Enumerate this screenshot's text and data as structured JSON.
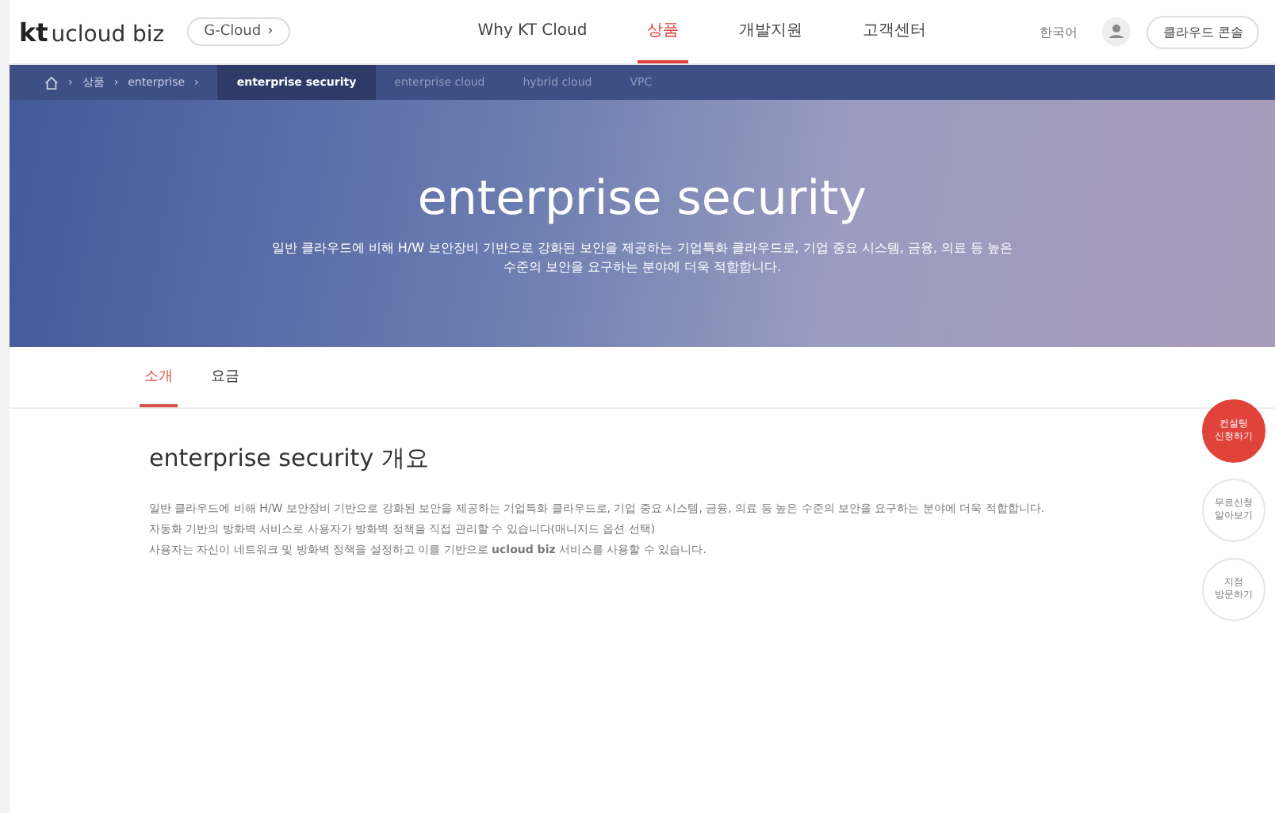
{
  "header": {
    "logo_mark": "kt",
    "logo_text": "ucloud biz",
    "service_chip": "G-Cloud",
    "service_chevron": "›",
    "nav": [
      {
        "label": "Why KT Cloud",
        "selected": false
      },
      {
        "label": "상품",
        "selected": true
      },
      {
        "label": "개발지원",
        "selected": false
      },
      {
        "label": "고객센터",
        "selected": false
      }
    ],
    "language": "한국어",
    "console_button": "클라우드 콘솔"
  },
  "breadcrumb": {
    "items": [
      "상품",
      "enterprise"
    ],
    "separator": "›",
    "tabs": [
      {
        "label": "enterprise security",
        "selected": true
      },
      {
        "label": "enterprise cloud",
        "selected": false
      },
      {
        "label": "hybrid cloud",
        "selected": false
      },
      {
        "label": "VPC",
        "selected": false
      }
    ]
  },
  "hero": {
    "title": "enterprise security",
    "subtitle_lines": [
      "일반 클라우드에 비해 H/W 보안장비 기반으로 강화된 보안을 제공하는 기업특화 클라우드로, 기업 중요 시스템, 금융, 의료 등 높은",
      "수준의 보안을 요구하는 분야에 더욱 적합합니다."
    ]
  },
  "tabs": [
    {
      "label": "소개",
      "selected": true
    },
    {
      "label": "요금",
      "selected": false
    }
  ],
  "overview": {
    "heading": "enterprise security 개요",
    "paragraphs": [
      "일반 클라우드에 비해 H/W 보안장비 기반으로 강화된 보안을 제공하는 기업특화 클라우드로, 기업 중요 시스템, 금융, 의료 등 높은 수준의 보안을 요구하는 분야에 더욱 적합합니다.",
      "자동화 기반의 방화벽 서비스로 사용자가 방화벽 정책을 직접 관리할 수 있습니다(매니지드 옵션 선택)",
      "사용자는 자신이 네트워크 및 방화벽 정책을 설정하고 이를 기반으로 **ucloud biz** 서비스를 사용할 수 있습니다."
    ]
  },
  "floating_buttons": [
    {
      "kind": "primary",
      "lines": [
        "컨설팅",
        "신청하기"
      ]
    },
    {
      "kind": "outline",
      "lines": [
        "무료신청",
        "알아보기"
      ]
    },
    {
      "kind": "outline",
      "lines": [
        "지점",
        "방문하기"
      ]
    }
  ]
}
